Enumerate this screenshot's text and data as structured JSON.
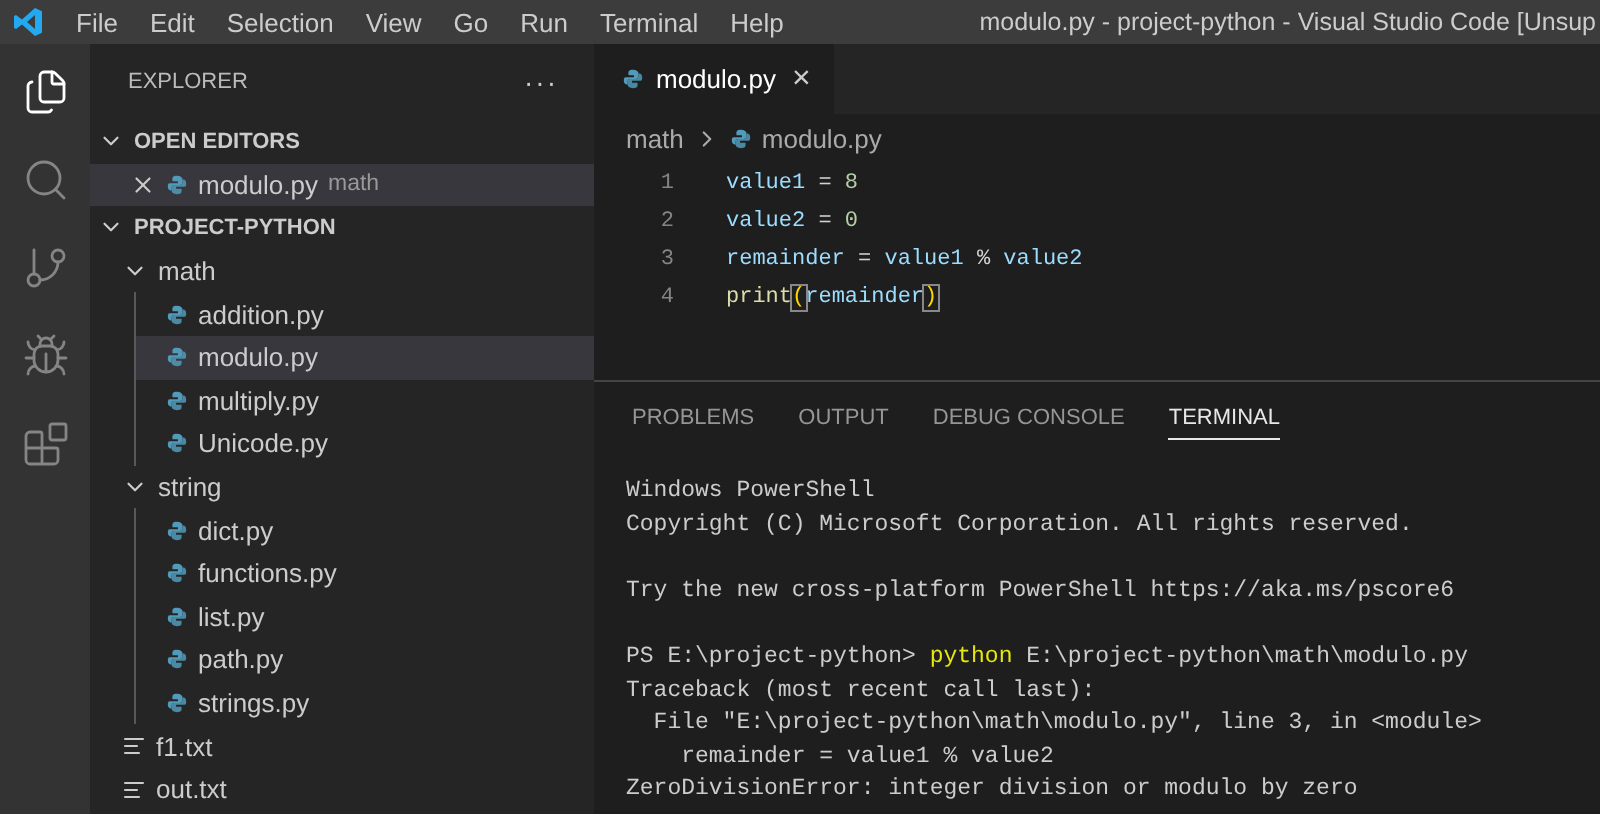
{
  "title_bar": {
    "menu": [
      "File",
      "Edit",
      "Selection",
      "View",
      "Go",
      "Run",
      "Terminal",
      "Help"
    ],
    "title": "modulo.py - project-python - Visual Studio Code [Unsup"
  },
  "activity_bar": [
    {
      "kind": "explorer",
      "selected": true
    },
    {
      "kind": "search",
      "selected": false
    },
    {
      "kind": "source-control",
      "selected": false
    },
    {
      "kind": "run",
      "selected": false
    },
    {
      "kind": "extensions",
      "selected": false
    }
  ],
  "sidebar": {
    "title": "EXPLORER",
    "more": "···",
    "open_editors": {
      "label": "OPEN EDITORS",
      "expanded": true,
      "items": [
        {
          "name": "modulo.py",
          "description": "math",
          "kind": "python",
          "selected": true
        }
      ]
    },
    "project": {
      "label": "PROJECT-PYTHON",
      "expanded": true,
      "items": [
        {
          "name": "math",
          "kind": "folder",
          "expanded": true,
          "selected": false,
          "children": [
            {
              "name": "addition.py",
              "kind": "python",
              "selected": false
            },
            {
              "name": "modulo.py",
              "kind": "python",
              "selected": true
            },
            {
              "name": "multiply.py",
              "kind": "python",
              "selected": false
            },
            {
              "name": "Unicode.py",
              "kind": "python",
              "selected": false
            }
          ]
        },
        {
          "name": "string",
          "kind": "folder",
          "expanded": true,
          "selected": false,
          "children": [
            {
              "name": "dict.py",
              "kind": "python",
              "selected": false
            },
            {
              "name": "functions.py",
              "kind": "python",
              "selected": false
            },
            {
              "name": "list.py",
              "kind": "python",
              "selected": false
            },
            {
              "name": "path.py",
              "kind": "python",
              "selected": false
            },
            {
              "name": "strings.py",
              "kind": "python",
              "selected": false
            }
          ]
        },
        {
          "name": "f1.txt",
          "kind": "text",
          "selected": false
        },
        {
          "name": "out.txt",
          "kind": "text",
          "selected": false
        }
      ]
    }
  },
  "editor": {
    "tabs": [
      {
        "label": "modulo.py",
        "close": "×",
        "selected": true
      }
    ],
    "breadcrumb": [
      "math",
      "modulo.py"
    ],
    "lines": [
      {
        "number": "1",
        "tokens": [
          {
            "text": "value1",
            "kind": "var"
          },
          {
            "text": " = ",
            "kind": "op"
          },
          {
            "text": "8",
            "kind": "num"
          }
        ]
      },
      {
        "number": "2",
        "tokens": [
          {
            "text": "value2",
            "kind": "var"
          },
          {
            "text": " = ",
            "kind": "op"
          },
          {
            "text": "0",
            "kind": "num"
          }
        ]
      },
      {
        "number": "3",
        "tokens": [
          {
            "text": "remainder",
            "kind": "var"
          },
          {
            "text": " = ",
            "kind": "op"
          },
          {
            "text": "value1",
            "kind": "var"
          },
          {
            "text": " % ",
            "kind": "op"
          },
          {
            "text": "value2",
            "kind": "var"
          }
        ]
      },
      {
        "number": "4",
        "tokens": [
          {
            "text": "print",
            "kind": "func"
          },
          {
            "text": "(",
            "kind": "bracket"
          },
          {
            "text": "remainder",
            "kind": "var"
          },
          {
            "text": ")",
            "kind": "bracket"
          }
        ]
      }
    ]
  },
  "panel": {
    "tabs": [
      {
        "label": "PROBLEMS",
        "selected": false
      },
      {
        "label": "OUTPUT",
        "selected": false
      },
      {
        "label": "DEBUG CONSOLE",
        "selected": false
      },
      {
        "label": "TERMINAL",
        "selected": true
      }
    ],
    "terminal": [
      [
        [
          {
            "text": "Windows PowerShell",
            "kind": "plain"
          }
        ],
        [
          {
            "text": "Copyright (C) Microsoft Corporation. All rights reserved.",
            "kind": "plain"
          }
        ]
      ],
      [
        [
          {
            "text": "Try the new cross-platform PowerShell https://aka.ms/pscore6",
            "kind": "plain"
          }
        ]
      ],
      [
        [
          {
            "text": "PS E:\\project-python> ",
            "kind": "plain"
          },
          {
            "text": "python",
            "kind": "command"
          },
          {
            "text": " E:\\project-python\\math\\modulo.py",
            "kind": "plain"
          }
        ],
        [
          {
            "text": "Traceback (most recent call last):",
            "kind": "plain"
          }
        ],
        [
          {
            "text": "  File \"E:\\project-python\\math\\modulo.py\", line 3, in <module>",
            "kind": "plain"
          }
        ],
        [
          {
            "text": "    remainder = value1 % value2",
            "kind": "plain"
          }
        ],
        [
          {
            "text": "ZeroDivisionError: integer division or modulo by zero",
            "kind": "plain"
          }
        ]
      ]
    ]
  }
}
